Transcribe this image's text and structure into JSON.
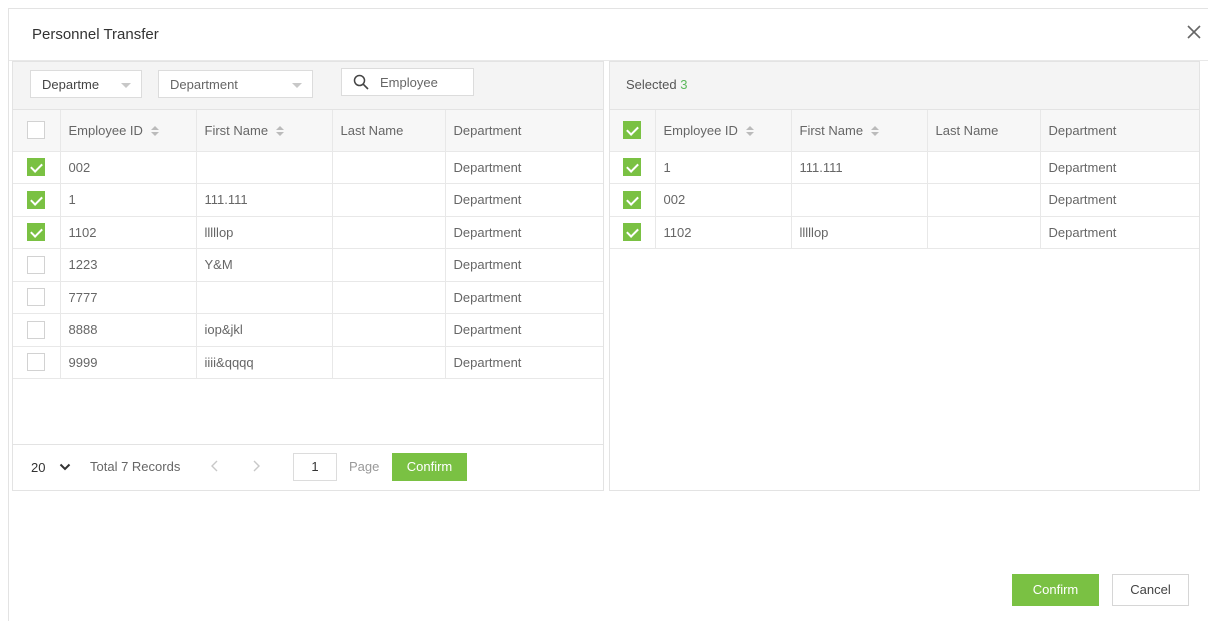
{
  "dialog": {
    "title": "Personnel Transfer"
  },
  "left_panel": {
    "filter1": {
      "value": "Departme"
    },
    "filter2": {
      "value": "Department"
    },
    "search": {
      "placeholder": "Employee"
    },
    "columns": [
      "Employee ID",
      "First Name",
      "Last Name",
      "Department"
    ],
    "rows": [
      {
        "checked": true,
        "id": "002",
        "first": "",
        "last": "",
        "dept": "Department"
      },
      {
        "checked": true,
        "id": "1",
        "first": "111.111",
        "last": "",
        "dept": "Department"
      },
      {
        "checked": true,
        "id": "1102",
        "first": "lllllop",
        "last": "",
        "dept": "Department"
      },
      {
        "checked": false,
        "id": "1223",
        "first": "Y&M",
        "last": "",
        "dept": "Department"
      },
      {
        "checked": false,
        "id": "7777",
        "first": "",
        "last": "",
        "dept": "Department"
      },
      {
        "checked": false,
        "id": "8888",
        "first": "iop&jkl",
        "last": "",
        "dept": "Department"
      },
      {
        "checked": false,
        "id": "9999",
        "first": "iiii&qqqq",
        "last": "",
        "dept": "Department"
      }
    ],
    "pager": {
      "page_size": "20",
      "total": "Total 7 Records",
      "page": "1",
      "page_label": "Page",
      "confirm": "Confirm"
    }
  },
  "right_panel": {
    "selected_label": "Selected",
    "selected_count": "3",
    "columns": [
      "Employee ID",
      "First Name",
      "Last Name",
      "Department"
    ],
    "rows": [
      {
        "checked": true,
        "id": "1",
        "first": "111.111",
        "last": "",
        "dept": "Department"
      },
      {
        "checked": true,
        "id": "002",
        "first": "",
        "last": "",
        "dept": "Department"
      },
      {
        "checked": true,
        "id": "1102",
        "first": "lllllop",
        "last": "",
        "dept": "Department"
      }
    ]
  },
  "footer": {
    "confirm": "Confirm",
    "cancel": "Cancel"
  },
  "colors": {
    "accent": "#7ac143",
    "count": "#5cb85c"
  }
}
